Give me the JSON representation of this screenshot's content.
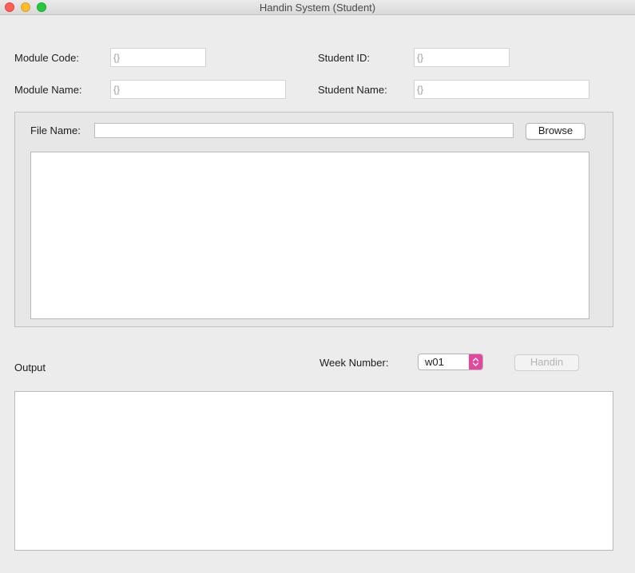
{
  "window": {
    "title": "Handin System (Student)"
  },
  "form": {
    "module_code_label": "Module Code:",
    "module_code_value": "{}",
    "module_name_label": "Module Name:",
    "module_name_value": "{}",
    "student_id_label": "Student ID:",
    "student_id_value": "{}",
    "student_name_label": "Student Name:",
    "student_name_value": "{}"
  },
  "file_panel": {
    "file_name_label": "File Name:",
    "file_name_value": "",
    "browse_label": "Browse",
    "content": ""
  },
  "submission": {
    "output_label": "Output",
    "week_number_label": "Week Number:",
    "week_selected": "w01",
    "handin_label": "Handin",
    "output_content": ""
  },
  "colors": {
    "window_background": "#ececec",
    "select_accent": "#e4479e",
    "close": "#fe5f57",
    "minimize": "#febc2e",
    "maximize": "#28c840"
  }
}
